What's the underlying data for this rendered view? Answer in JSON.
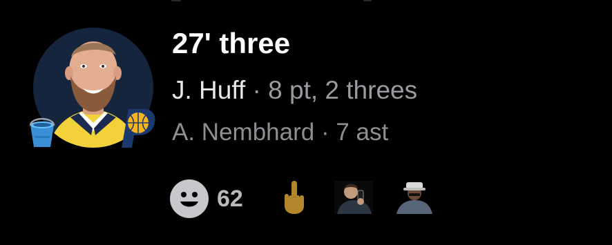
{
  "play": {
    "title": "27' three",
    "scorer": {
      "name": "J. Huff",
      "separator": "·",
      "stat": "8 pt, 2 threes"
    },
    "assist": {
      "name": "A. Nembhard",
      "separator": "·",
      "stat": "7 ast"
    }
  },
  "avatar": {
    "badge_icon": "bucket-icon",
    "team_logo": "pacers-logo"
  },
  "reactions": {
    "add_icon": "smiley-icon",
    "count": "62",
    "emojis": [
      "middle-finger-emoji",
      "custom-emoji-man-phone",
      "custom-emoji-person-hat"
    ]
  },
  "colors": {
    "background": "#000000",
    "title": "#ffffff",
    "secondary": "#9a9aa0",
    "avatar_bg": "#15253d",
    "pacers_blue": "#1d3a6e",
    "pacers_gold": "#f6b51c"
  }
}
